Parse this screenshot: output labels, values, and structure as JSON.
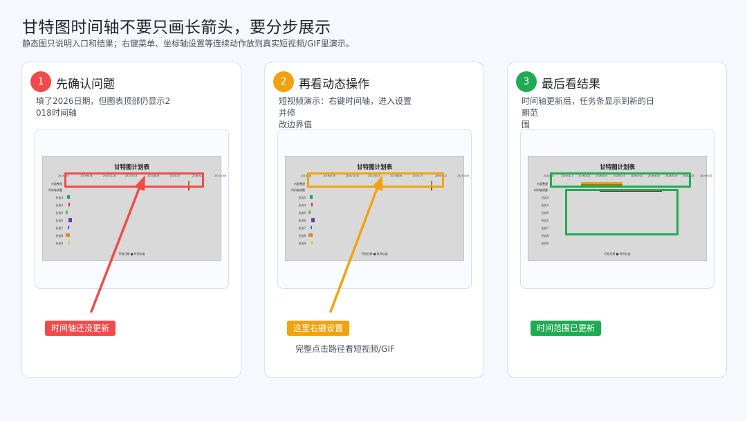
{
  "header": {
    "title": "甘特图时间轴不要只画长箭头，要分步展示",
    "subtitle": "静态图只说明入口和结果；右键菜单、坐标轴设置等连续动作放到真实短视频/GIF里演示。"
  },
  "colors": {
    "step1": "#ef4b4b",
    "step2": "#f2a20e",
    "step3": "#1faa54"
  },
  "steps": [
    {
      "number": "1",
      "title": "先确认问题",
      "desc": "填了2026日期，但图表顶部仍显示2\n018时间轴",
      "tag": "时间轴还没更新"
    },
    {
      "number": "2",
      "title": "再看动态操作",
      "desc": "短视频演示：右键时间轴，进入设置并修\n改边界值",
      "tag": "这里右键设置",
      "link": "完整点击路径看短视频/GIF"
    },
    {
      "number": "3",
      "title": "最后看结果",
      "desc": "时间轴更新后，任务条显示到新的日期范\n围",
      "tag": "时间范围已更新"
    }
  ],
  "gantt": {
    "title": "甘特图计划表",
    "legend": "开始日期 ■ 时间长度",
    "row_labels": [
      "内容整理",
      "时间轴调整",
      "任务3",
      "任务4",
      "任务5",
      "任务6",
      "任务7",
      "任务8",
      "任务9"
    ],
    "old_ticks": [
      "2018/1/4",
      "2019/6/18",
      "2020/11/30",
      "2022/4/13",
      "2023/8/26",
      "2025/1/7",
      "2026/5/22",
      "2027/10/5"
    ],
    "new_ticks": [
      "2026/3/1",
      "2026/3/11",
      "2026/3/21",
      "2026/3/31",
      "2026/4/10",
      "2026/4/20",
      "2026/4/30",
      "2026/5/10",
      "2026/5/20",
      "2026/5/30"
    ]
  }
}
